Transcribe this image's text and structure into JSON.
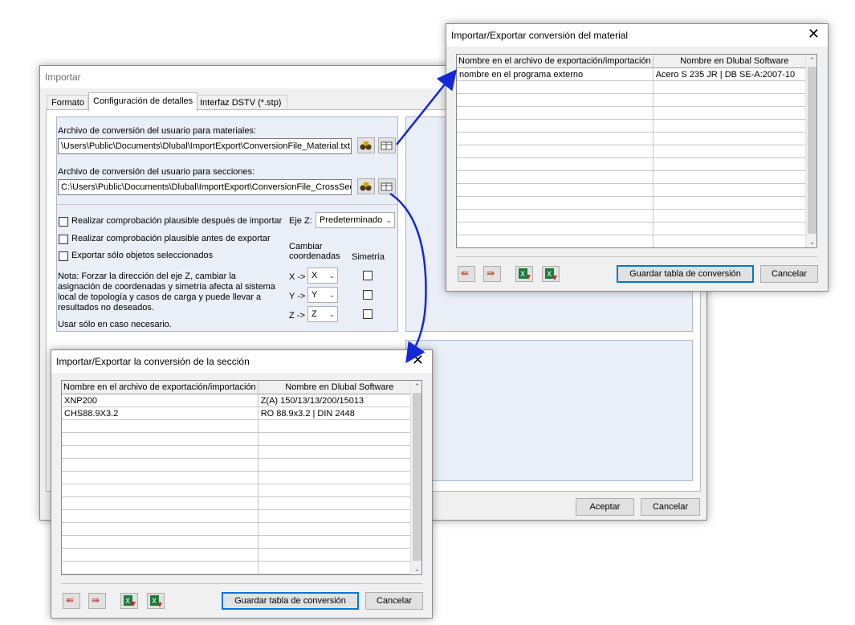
{
  "importar": {
    "title": "Importar",
    "tabs": [
      "Formato",
      "Configuración de detalles",
      "Interfaz DSTV (*.stp)"
    ],
    "materials_label": "Archivo de conversión del usuario para materiales:",
    "materials_path": "\\Users\\Public\\Documents\\Dlubal\\ImportExport\\ConversionFile_Material.txt",
    "sections_label": "Archivo de conversión del usuario para secciones:",
    "sections_path": "C:\\Users\\Public\\Documents\\Dlubal\\ImportExport\\ConversionFile_CrossSect",
    "check_import": "Realizar comprobación plausible después de importar",
    "check_export": "Realizar comprobación plausible antes de exportar",
    "check_selected": "Exportar sólo objetos seleccionados",
    "eje_z_label": "Eje Z:",
    "eje_z_value": "Predeterminado",
    "cambiar_label": "Cambiar\ncoordenadas",
    "simetria_label": "Simetría",
    "axes": [
      {
        "label": "X ->",
        "value": "X"
      },
      {
        "label": "Y ->",
        "value": "Y"
      },
      {
        "label": "Z ->",
        "value": "Z"
      }
    ],
    "note": "Nota: Forzar la dirección del eje Z, cambiar la asignación de coordenadas y simetría afecta al sistema local de topología y casos de carga y puede llevar a resultados no deseados.",
    "note2": "Usar sólo en caso necesario.",
    "accept": "Aceptar",
    "cancel": "Cancelar"
  },
  "material_dialog": {
    "title": "Importar/Exportar conversión del material",
    "col1": "Nombre en el archivo de exportación/importación",
    "col2": "Nombre en Dlubal Software",
    "rows": [
      {
        "ext": "nombre en el programa externo",
        "dlubal": "Acero S 235 JR | DB SE-A:2007-10"
      }
    ],
    "save": "Guardar tabla de conversión",
    "cancel": "Cancelar"
  },
  "section_dialog": {
    "title": "Importar/Exportar la conversión de la sección",
    "col1": "Nombre en el archivo de exportación/importación",
    "col2": "Nombre en Dlubal Software",
    "rows": [
      {
        "ext": "XNP200",
        "dlubal": "Z(A) 150/13/13/200/15013"
      },
      {
        "ext": "CHS88.9X3.2",
        "dlubal": "RO 88.9x3.2 | DIN 2448"
      }
    ],
    "save": "Guardar tabla de conversión",
    "cancel": "Cancelar"
  },
  "colors": {
    "arrow": "#1428d8",
    "panel": "#e9eef7",
    "default_border": "#0078d7"
  }
}
